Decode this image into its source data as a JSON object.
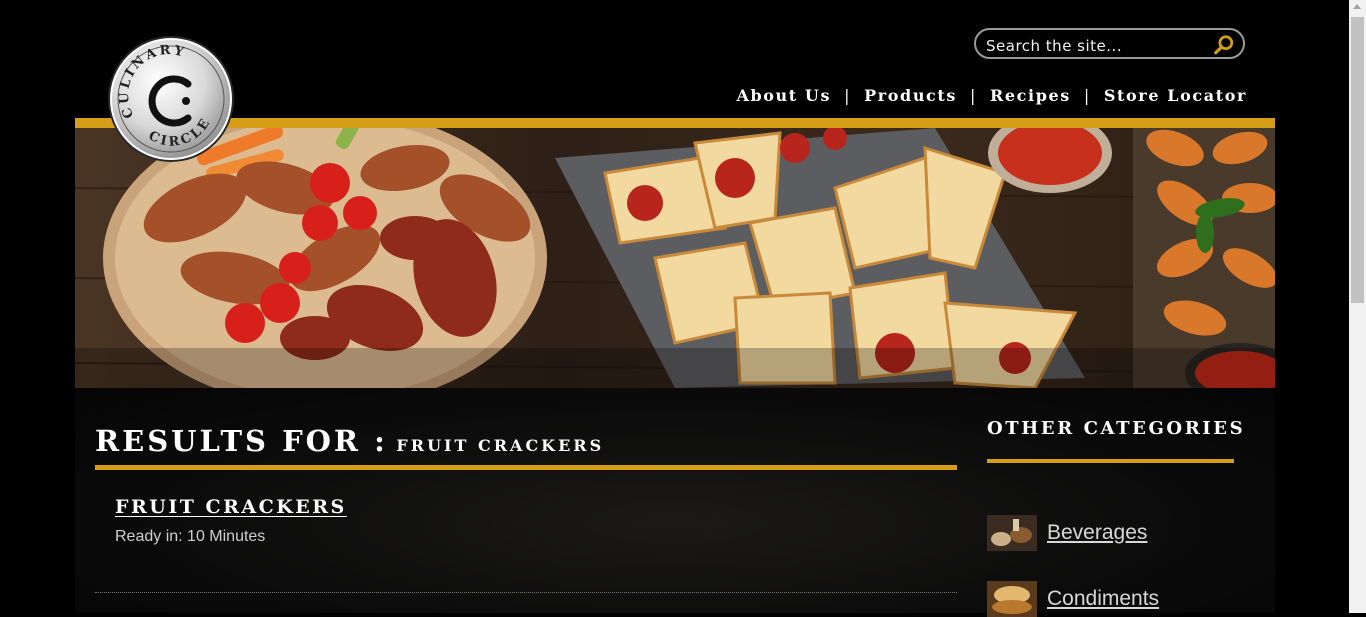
{
  "header": {
    "logo_text": "CULINARY CIRCLE",
    "search": {
      "placeholder": "Search the site...",
      "value": ""
    },
    "nav": [
      {
        "label": "About Us"
      },
      {
        "label": "Products"
      },
      {
        "label": "Recipes"
      },
      {
        "label": "Store Locator"
      }
    ]
  },
  "results": {
    "heading_prefix": "RESULTS FOR :",
    "query": "FRUIT CRACKERS",
    "items": [
      {
        "title": "FRUIT CRACKERS",
        "meta": "Ready in: 10 Minutes"
      }
    ]
  },
  "sidebar": {
    "title": "OTHER CATEGORIES",
    "categories": [
      {
        "label": "Beverages"
      },
      {
        "label": "Condiments"
      }
    ]
  },
  "colors": {
    "accent": "#d69e17",
    "background": "#000000"
  },
  "icons": [
    "search-icon",
    "culinary-circle-logo"
  ]
}
